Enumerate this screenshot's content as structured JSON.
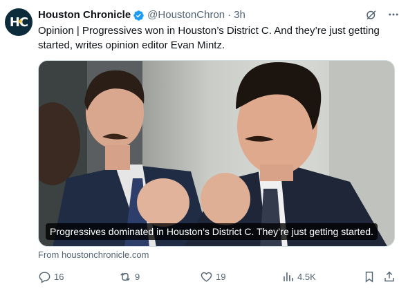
{
  "author": {
    "avatar_text": "HC",
    "display_name": "Houston Chronicle",
    "handle": "@HoustonChron",
    "separator": "·",
    "time": "3h",
    "verified_color": "#1d9bf0"
  },
  "tweet": {
    "text": "Opinion | Progressives won in Houston’s District C. And they’re just getting started, writes opinion editor Evan Mintz."
  },
  "card": {
    "caption": "Progressives dominated in Houston’s District C. They’re just getting started.",
    "source": "From houstonchronicle.com"
  },
  "actions": {
    "replies": "16",
    "reposts": "9",
    "likes": "19",
    "views": "4.5K"
  },
  "icons": [
    "grok-icon",
    "more-icon",
    "reply-icon",
    "repost-icon",
    "like-icon",
    "views-icon",
    "bookmark-icon",
    "share-icon"
  ],
  "colors": {
    "text_primary": "#0f1419",
    "text_secondary": "#536471",
    "avatar_bg": "#0c2c3c",
    "accent_star": "#f2c230"
  }
}
